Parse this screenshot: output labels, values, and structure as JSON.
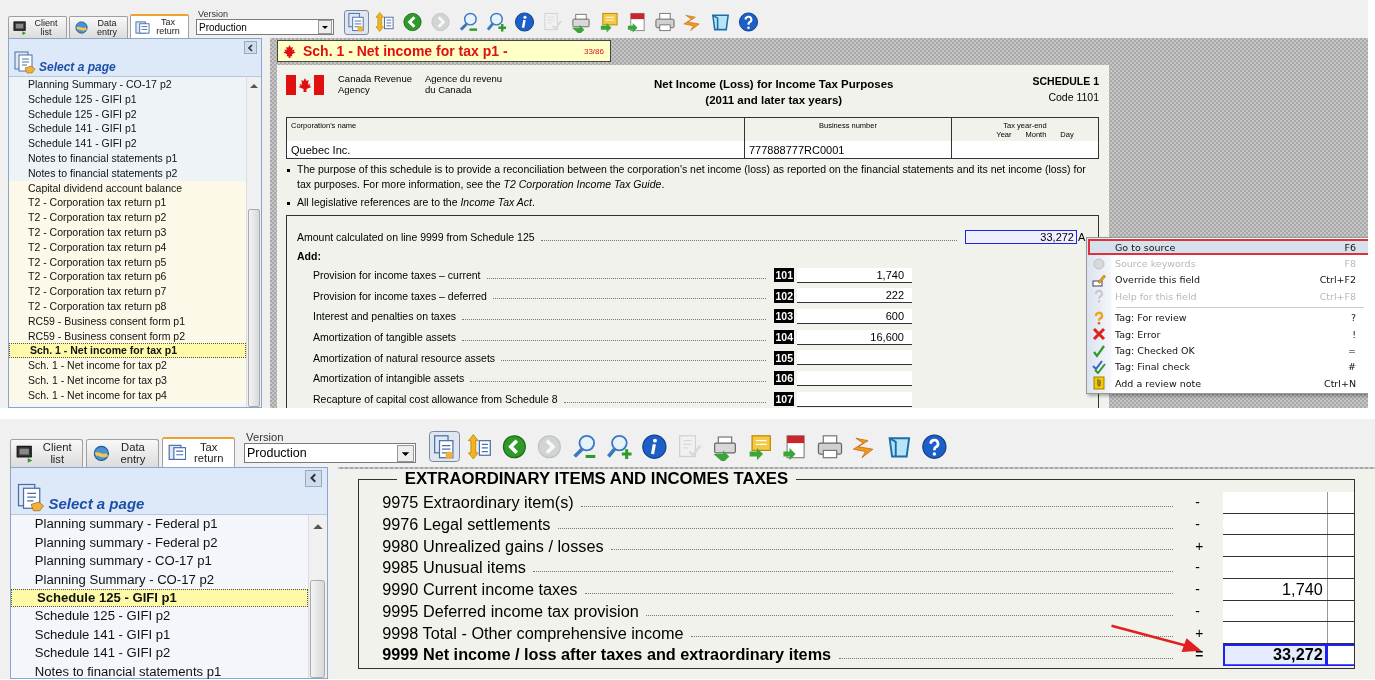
{
  "top": {
    "tabs": [
      {
        "label": "Client list",
        "kind": "clients",
        "selected": false
      },
      {
        "label": "Data entry",
        "kind": "entry",
        "selected": false
      },
      {
        "label": "Tax return",
        "kind": "return",
        "selected": true
      }
    ],
    "version_label": "Version",
    "version": "Production",
    "toolbar": [
      {
        "kind": "pages",
        "pressed": true,
        "disabled": false
      },
      {
        "kind": "sort",
        "pressed": false,
        "disabled": false
      },
      {
        "kind": "back",
        "pressed": false,
        "disabled": false
      },
      {
        "kind": "forward",
        "pressed": false,
        "disabled": true
      },
      {
        "kind": "zoom-out",
        "pressed": false,
        "disabled": false
      },
      {
        "kind": "zoom-in",
        "pressed": false,
        "disabled": false
      },
      {
        "kind": "info",
        "pressed": false,
        "disabled": false
      },
      {
        "kind": "review",
        "pressed": false,
        "disabled": true
      },
      {
        "kind": "print-send",
        "pressed": false,
        "disabled": false
      },
      {
        "kind": "export",
        "pressed": false,
        "disabled": false
      },
      {
        "kind": "pdf",
        "pressed": false,
        "disabled": false
      },
      {
        "kind": "printer",
        "pressed": false,
        "disabled": false
      },
      {
        "kind": "lightning",
        "pressed": false,
        "disabled": false
      },
      {
        "kind": "window",
        "pressed": false,
        "disabled": false
      },
      {
        "kind": "help",
        "pressed": false,
        "disabled": false
      }
    ],
    "sidebar": {
      "heading": "Select a page",
      "items": [
        {
          "label": "Planning Summary - CO-17 p2",
          "selected": false,
          "color": "#eef3f8"
        },
        {
          "label": "Schedule 125 - GIFI p1",
          "selected": false,
          "color": "#eef3f8"
        },
        {
          "label": "Schedule 125 - GIFI p2",
          "selected": false,
          "color": "#eef3f8"
        },
        {
          "label": "Schedule 141 - GIFI p1",
          "selected": false,
          "color": "#eef3f8"
        },
        {
          "label": "Schedule 141 - GIFI p2",
          "selected": false,
          "color": "#eef3f8"
        },
        {
          "label": "Notes to financial statements p1",
          "selected": false,
          "color": "#eef3f8"
        },
        {
          "label": "Notes to financial statements p2",
          "selected": false,
          "color": "#eef3f8"
        },
        {
          "label": "Capital dividend account balance",
          "selected": false,
          "color": "#fcf9e8"
        },
        {
          "label": "T2 - Corporation tax return p1",
          "selected": false,
          "color": "#fcf9e8"
        },
        {
          "label": "T2 - Corporation tax return p2",
          "selected": false,
          "color": "#fcf9e8"
        },
        {
          "label": "T2 - Corporation tax return p3",
          "selected": false,
          "color": "#fcf9e8"
        },
        {
          "label": "T2 - Corporation tax return p4",
          "selected": false,
          "color": "#fcf9e8"
        },
        {
          "label": "T2 - Corporation tax return p5",
          "selected": false,
          "color": "#fcf9e8"
        },
        {
          "label": "T2 - Corporation tax return p6",
          "selected": false,
          "color": "#fcf9e8"
        },
        {
          "label": "T2 - Corporation tax return p7",
          "selected": false,
          "color": "#fcf9e8"
        },
        {
          "label": "T2 - Corporation tax return p8",
          "selected": false,
          "color": "#fcf9e8"
        },
        {
          "label": "RC59 - Business consent form p1",
          "selected": false,
          "color": "#fcf9e8"
        },
        {
          "label": "RC59 - Business consent form p2",
          "selected": false,
          "color": "#fcf9e8"
        },
        {
          "label": "Sch. 1 - Net income for tax p1",
          "selected": true
        },
        {
          "label": "Sch. 1 - Net income for tax p2",
          "selected": false,
          "color": "#fcf9e8"
        },
        {
          "label": "Sch. 1 - Net income for tax p3",
          "selected": false,
          "color": "#fcf9e8"
        },
        {
          "label": "Sch. 1 - Net income for tax p4",
          "selected": false,
          "color": "#fcf9e8"
        }
      ]
    },
    "page_title": {
      "title": "Sch. 1 - Net income for tax p1 -",
      "counter": "33/86"
    },
    "form": {
      "agency_en": "Canada Revenue Agency",
      "agency_fr": "Agence du revenu du Canada",
      "title": "Net Income (Loss) for Income Tax Purposes",
      "subtitle": "(2011 and later tax years)",
      "schedule": "SCHEDULE 1",
      "code": "Code 1101",
      "fields": [
        {
          "label": "Corporation's name",
          "value": "Quebec Inc."
        },
        {
          "label": "Business number",
          "value": "777888777RC0001"
        },
        {
          "label": "Tax year-end",
          "sublabels": [
            "Year",
            "Month",
            "Day"
          ]
        }
      ],
      "bullets": [
        "The purpose of this schedule is to provide a reconciliation between the corporation's net income (loss) as reported on the financial statements and its net income (loss) for tax purposes. For more information, see the *T2 Corporation Income Tax Guide*.",
        "All legislative references are to the *Income Tax Act*."
      ],
      "lines": [
        {
          "kind": "amount",
          "label": "Amount calculated on line 9999 from Schedule 125",
          "value": "33,272",
          "suffix": "A",
          "focused": true
        },
        {
          "kind": "heading",
          "label": "Add:"
        },
        {
          "kind": "line",
          "label": "Provision for income taxes – current",
          "code": "101",
          "value": "1,740",
          "focused": false
        },
        {
          "kind": "line",
          "label": "Provision for income taxes – deferred",
          "code": "102",
          "value": "222",
          "focused": false
        },
        {
          "kind": "line",
          "label": "Interest and penalties on taxes",
          "code": "103",
          "value": "600",
          "focused": false
        },
        {
          "kind": "line",
          "label": "Amortization of tangible assets",
          "code": "104",
          "value": "16,600",
          "focused": false
        },
        {
          "kind": "line",
          "label": "Amortization of natural resource assets",
          "code": "105",
          "focused": false
        },
        {
          "kind": "line",
          "label": "Amortization of intangible assets",
          "code": "106",
          "focused": false
        },
        {
          "kind": "line",
          "label": "Recapture of capital cost allowance from Schedule 8",
          "code": "107",
          "focused": false
        }
      ]
    },
    "context_menu": [
      {
        "kind": "source",
        "label": "Go to source",
        "shortcut": "F6",
        "selected": true,
        "disabled": false
      },
      {
        "kind": "keywords",
        "label": "Source keywords",
        "shortcut": "F8",
        "selected": false,
        "disabled": true
      },
      {
        "kind": "override",
        "label": "Override this field",
        "shortcut": "Ctrl+F2",
        "selected": false,
        "disabled": false
      },
      {
        "kind": "help",
        "label": "Help for this field",
        "shortcut": "Ctrl+F8",
        "selected": false,
        "disabled": true
      },
      {
        "kind": "separator"
      },
      {
        "kind": "review",
        "label": "Tag: For review",
        "shortcut": "?",
        "selected": false,
        "disabled": false
      },
      {
        "kind": "error",
        "label": "Tag: Error",
        "shortcut": "!",
        "selected": false,
        "disabled": false
      },
      {
        "kind": "checked",
        "label": "Tag: Checked OK",
        "shortcut": "=",
        "selected": false,
        "disabled": false
      },
      {
        "kind": "final",
        "label": "Tag: Final check",
        "shortcut": "#",
        "selected": false,
        "disabled": false
      },
      {
        "kind": "note",
        "label": "Add a review note",
        "shortcut": "Ctrl+N",
        "selected": false,
        "disabled": false
      }
    ]
  },
  "bottom": {
    "tabs": [
      {
        "label": "Client list",
        "kind": "clients",
        "selected": false
      },
      {
        "label": "Data entry",
        "kind": "entry",
        "selected": false
      },
      {
        "label": "Tax return",
        "kind": "return",
        "selected": true
      }
    ],
    "version_label": "Version",
    "version": "Production",
    "toolbar": [
      {
        "kind": "pages",
        "pressed": true,
        "disabled": false
      },
      {
        "kind": "sort",
        "pressed": false,
        "disabled": false
      },
      {
        "kind": "back",
        "pressed": false,
        "disabled": false
      },
      {
        "kind": "forward",
        "pressed": false,
        "disabled": true
      },
      {
        "kind": "zoom-out",
        "pressed": false,
        "disabled": false
      },
      {
        "kind": "zoom-in",
        "pressed": false,
        "disabled": false
      },
      {
        "kind": "info",
        "pressed": false,
        "disabled": false
      },
      {
        "kind": "review",
        "pressed": false,
        "disabled": true
      },
      {
        "kind": "print-send",
        "pressed": false,
        "disabled": false
      },
      {
        "kind": "export",
        "pressed": false,
        "disabled": false
      },
      {
        "kind": "pdf",
        "pressed": false,
        "disabled": false
      },
      {
        "kind": "printer",
        "pressed": false,
        "disabled": false
      },
      {
        "kind": "lightning",
        "pressed": false,
        "disabled": false
      },
      {
        "kind": "window",
        "pressed": false,
        "disabled": false
      },
      {
        "kind": "help",
        "pressed": false,
        "disabled": false
      }
    ],
    "sidebar": {
      "heading": "Select a page",
      "items": [
        {
          "label": "Planning summary - Federal p1",
          "selected": false
        },
        {
          "label": "Planning summary - Federal p2",
          "selected": false
        },
        {
          "label": "Planning summary - CO-17 p1",
          "selected": false
        },
        {
          "label": "Planning Summary - CO-17 p2",
          "selected": false
        },
        {
          "label": "Schedule 125 - GIFI p1",
          "selected": true
        },
        {
          "label": "Schedule 125 - GIFI p2",
          "selected": false
        },
        {
          "label": "Schedule 141 - GIFI p1",
          "selected": false
        },
        {
          "label": "Schedule 141 - GIFI p2",
          "selected": false
        },
        {
          "label": "Notes to financial statements p1",
          "selected": false
        }
      ]
    },
    "section": {
      "title": "EXTRAORDINARY ITEMS AND INCOMES TAXES",
      "rows": [
        {
          "kind": "line",
          "label": "9975 Extraordinary item(s)",
          "sign": "-",
          "focused": false
        },
        {
          "kind": "line",
          "label": "9976 Legal settlements",
          "sign": "-",
          "focused": false
        },
        {
          "kind": "line",
          "label": "9980 Unrealized gains / losses",
          "sign": "+",
          "focused": false
        },
        {
          "kind": "line",
          "label": "9985 Unusual items",
          "sign": "-",
          "focused": false
        },
        {
          "kind": "line",
          "label": "9990 Current income taxes",
          "sign": "-",
          "value": "1,740",
          "focused": false
        },
        {
          "kind": "line",
          "label": "9995 Deferred income tax provision",
          "sign": "-",
          "focused": false
        },
        {
          "kind": "line",
          "label": "9998 Total - Other comprehensive income",
          "sign": "+",
          "focused": false
        },
        {
          "kind": "total",
          "label": "9999 Net income / loss after taxes and extraordinary items",
          "sign": "=",
          "value": "33,272",
          "focused": true
        }
      ]
    }
  }
}
